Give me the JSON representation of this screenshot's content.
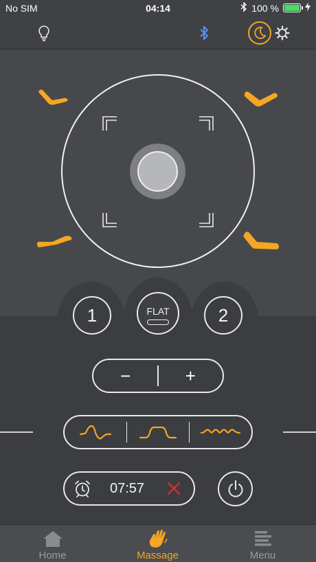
{
  "status_bar": {
    "carrier": "No SIM",
    "time": "04:14",
    "battery_text": "100 %",
    "battery_level": 1.0
  },
  "toolbar": {
    "icons": [
      "lightbulb-icon",
      "bluetooth-icon",
      "moon-icon",
      "gear-icon"
    ]
  },
  "presets": {
    "one_label": "1",
    "flat_label": "FLAT",
    "two_label": "2"
  },
  "adjust": {
    "minus_label": "−",
    "plus_label": "+"
  },
  "timer": {
    "value": "07:57"
  },
  "nav": {
    "items": [
      {
        "label": "Home"
      },
      {
        "label": "Massage"
      },
      {
        "label": "Menu"
      }
    ],
    "active_index": 1
  },
  "colors": {
    "accent": "#f5a623",
    "bluetooth": "#5d8ff0",
    "cancel": "#e0302b",
    "battery": "#4cd964",
    "background": "#3f4145"
  }
}
